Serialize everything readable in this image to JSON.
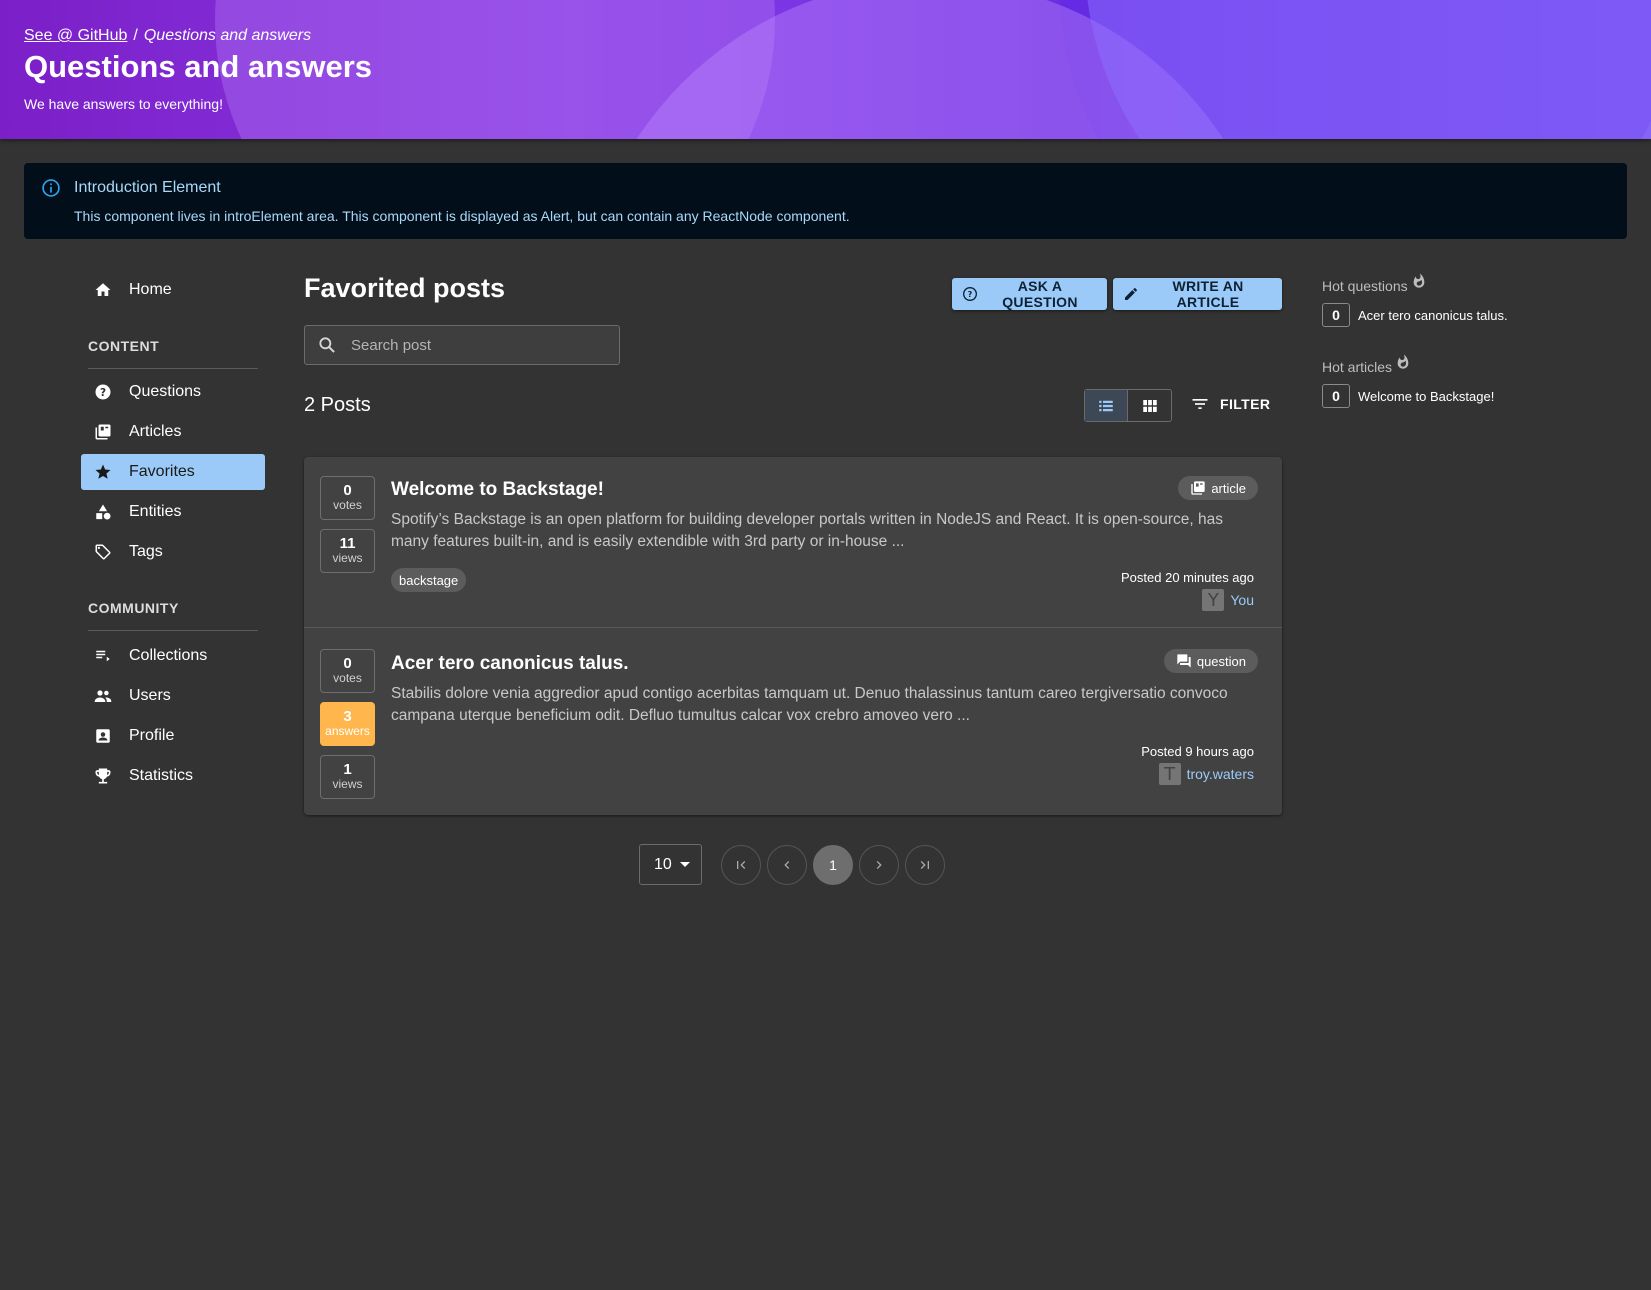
{
  "header": {
    "breadcrumb_link": "See @ GitHub",
    "breadcrumb_separator": "/",
    "breadcrumb_current": "Questions and answers",
    "title": "Questions and answers",
    "subtitle": "We have answers to everything!"
  },
  "intro": {
    "title": "Introduction Element",
    "text": "This component lives in introElement area. This component is displayed as Alert, but can contain any ReactNode component."
  },
  "sidebar": {
    "home": "Home",
    "content_heading": "CONTENT",
    "content_items": [
      "Questions",
      "Articles",
      "Favorites",
      "Entities",
      "Tags"
    ],
    "active_item": "Favorites",
    "community_heading": "COMMUNITY",
    "community_items": [
      "Collections",
      "Users",
      "Profile",
      "Statistics"
    ]
  },
  "main": {
    "title": "Favorited posts",
    "ask_button": "ASK A QUESTION",
    "write_button": "WRITE AN ARTICLE",
    "search_placeholder": "Search post",
    "posts_count": "2 Posts",
    "filter_label": "FILTER",
    "posts": [
      {
        "title": "Welcome to Backstage!",
        "body": "Spotify’s Backstage is an open platform for building developer portals written in NodeJS and React. It is open-source, has many features built-in, and is easily extendible with 3rd party or in-house ...",
        "type": "article",
        "votes": "0",
        "votes_label": "votes",
        "views": "11",
        "views_label": "views",
        "tag": "backstage",
        "posted": "Posted 20 minutes ago",
        "author_initial": "Y",
        "author": "You"
      },
      {
        "title": "Acer tero canonicus talus.",
        "body": "Stabilis dolore venia aggredior apud contigo acerbitas tamquam ut. Denuo thalassinus tantum careo tergiversatio convoco campana uterque beneficium odit. Defluo tumultus calcar vox crebro amoveo vero ...",
        "type": "question",
        "votes": "0",
        "votes_label": "votes",
        "answers": "3",
        "answers_label": "answers",
        "views": "1",
        "views_label": "views",
        "posted": "Posted 9 hours ago",
        "author_initial": "T",
        "author": "troy.waters"
      }
    ]
  },
  "pagination": {
    "page_size": "10",
    "current_page": "1"
  },
  "right": {
    "hot_questions_heading": "Hot questions",
    "hot_question": {
      "count": "0",
      "title": "Acer tero canonicus talus."
    },
    "hot_articles_heading": "Hot articles",
    "hot_article": {
      "count": "0",
      "title": "Welcome to Backstage!"
    }
  },
  "colors": {
    "active_nav": "#9ccaf8",
    "primary_button": "#9ccaf8",
    "answered_badge": "#ffb74d",
    "link": "#9ccaf8",
    "background": "#333333"
  }
}
